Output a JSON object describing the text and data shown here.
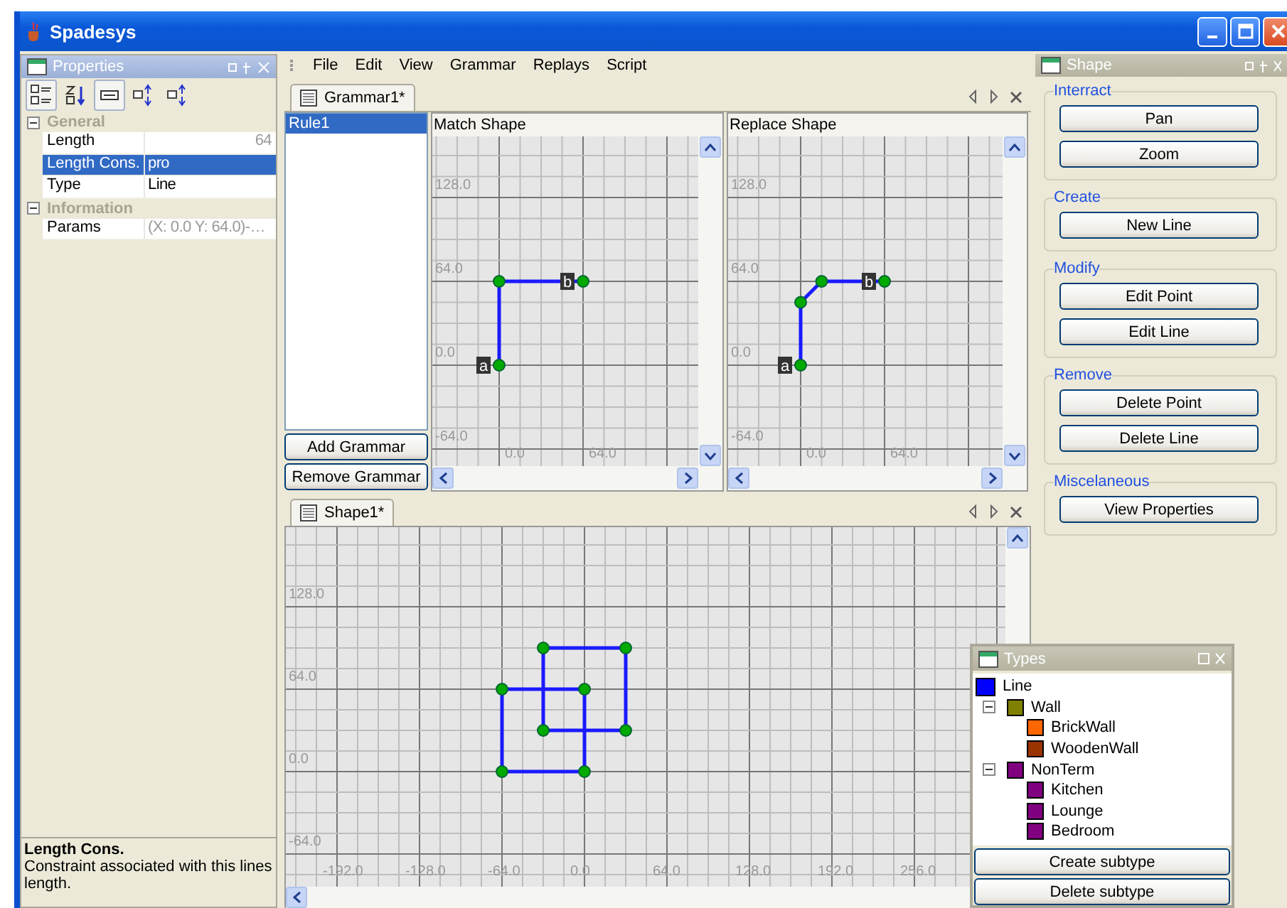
{
  "window": {
    "title": "Spadesys"
  },
  "properties_panel": {
    "title": "Properties",
    "toolbar": [
      {
        "selected": true
      },
      {
        "selected": false
      },
      {
        "selected": true
      },
      {
        "selected": false
      },
      {
        "selected": false
      }
    ],
    "categories": [
      {
        "name": "General",
        "expanded": true,
        "rows": [
          {
            "name": "Length",
            "value": "64",
            "selected": false,
            "read_only": true
          },
          {
            "name": "Length Cons.",
            "value": "pro",
            "selected": true,
            "read_only": false
          },
          {
            "name": "Type",
            "value": "Line",
            "selected": false,
            "read_only": false
          }
        ]
      },
      {
        "name": "Information",
        "expanded": true,
        "rows": [
          {
            "name": "Params",
            "value": "(X: 0.0 Y: 64.0)-…",
            "selected": false,
            "read_only": true
          }
        ]
      }
    ],
    "description": {
      "title": "Length Cons.",
      "text": "Constraint associated with this lines length."
    }
  },
  "menu": [
    "File",
    "Edit",
    "View",
    "Grammar",
    "Replays",
    "Script"
  ],
  "grammar_tab": {
    "label": "Grammar1*",
    "rules": [
      {
        "label": "Rule1",
        "selected": true
      }
    ],
    "buttons": [
      "Add Grammar",
      "Remove Grammar"
    ],
    "canvases": [
      {
        "kind": "match",
        "title": "Match Shape",
        "y_ticks": [
          "128.0",
          "64.0",
          "0.0",
          "-64.0"
        ],
        "x_ticks": [
          "0.0",
          "64.0"
        ],
        "point_labels": [
          "a",
          "b"
        ]
      },
      {
        "kind": "replace",
        "title": "Replace Shape",
        "y_ticks": [
          "128.0",
          "64.0",
          "0.0",
          "-64.0"
        ],
        "x_ticks": [
          "0.0",
          "64.0"
        ],
        "point_labels": [
          "a",
          "b"
        ]
      }
    ]
  },
  "shape_tab": {
    "label": "Shape1*",
    "canvas": {
      "kind": "shape",
      "y_ticks": [
        "128.0",
        "64.0",
        "0.0",
        "-64.0"
      ],
      "x_ticks": [
        "-192.0",
        "-128.0",
        "-64.0",
        "0.0",
        "64.0",
        "128.0",
        "192.0",
        "256.0"
      ]
    }
  },
  "shape_panel": {
    "title": "Shape",
    "groups": [
      {
        "title": "Interract",
        "buttons": [
          "Pan",
          "Zoom"
        ]
      },
      {
        "title": "Create",
        "buttons": [
          "New Line"
        ]
      },
      {
        "title": "Modify",
        "buttons": [
          "Edit Point",
          "Edit Line"
        ]
      },
      {
        "title": "Remove",
        "buttons": [
          "Delete Point",
          "Delete Line"
        ]
      },
      {
        "title": "Miscelaneous",
        "buttons": [
          "View Properties"
        ]
      }
    ]
  },
  "types_window": {
    "title": "Types",
    "items": [
      {
        "label": "Line",
        "color": "#0000ff"
      },
      {
        "label": "Wall",
        "color": "#808000",
        "expanded": true,
        "children": [
          {
            "label": "BrickWall",
            "color": "#ff6600"
          },
          {
            "label": "WoodenWall",
            "color": "#993300"
          }
        ]
      },
      {
        "label": "NonTerm",
        "color": "#800080",
        "expanded": true,
        "children": [
          {
            "label": "Kitchen",
            "color": "#800080"
          },
          {
            "label": "Lounge",
            "color": "#800080"
          },
          {
            "label": "Bedroom",
            "color": "#800080"
          }
        ]
      }
    ],
    "buttons": [
      "Create subtype",
      "Delete subtype"
    ]
  }
}
